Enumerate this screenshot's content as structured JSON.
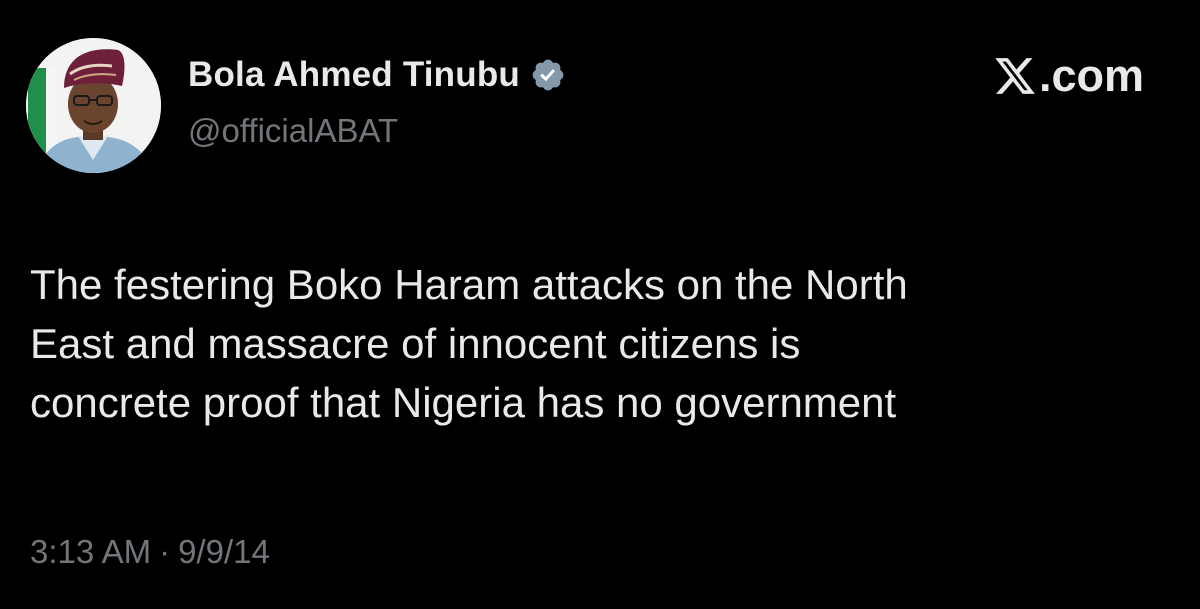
{
  "author": {
    "display_name": "Bola Ahmed Tinubu",
    "handle": "@officialABAT",
    "verified_icon": "verified-badge-icon",
    "avatar": "profile-photo"
  },
  "brand": {
    "icon": "x-logo-icon",
    "label": ".com"
  },
  "tweet": {
    "lines": [
      "The festering Boko Haram attacks on the North",
      "East and massacre of innocent citizens is",
      "concrete proof that Nigeria has no government"
    ]
  },
  "meta": {
    "time": "3:13 AM",
    "separator": "·",
    "date": "9/9/14"
  },
  "colors": {
    "background": "#000000",
    "primary_text": "#e7e9ea",
    "secondary_text": "#71767b",
    "verified_badge": "#829aab"
  }
}
